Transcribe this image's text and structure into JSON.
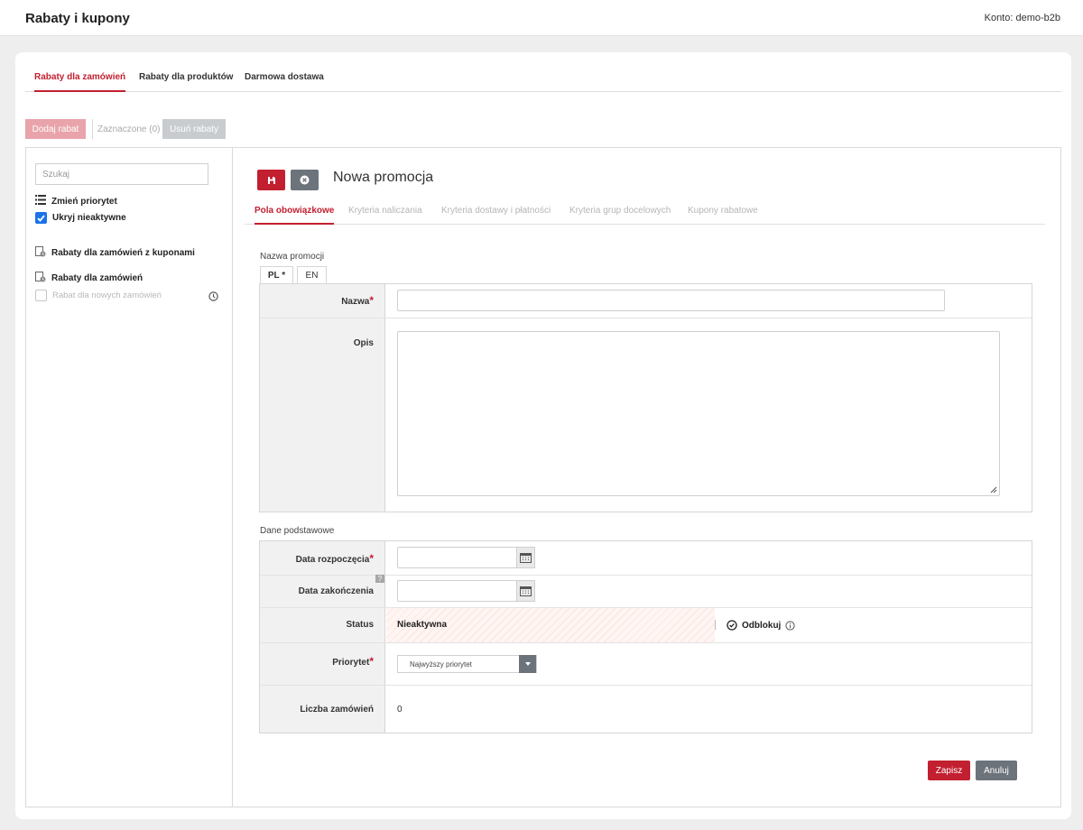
{
  "header": {
    "title": "Rabaty i kupony",
    "account": "Konto: demo-b2b"
  },
  "tabs": [
    {
      "label": "Rabaty dla zamówień"
    },
    {
      "label": "Rabaty dla produktów"
    },
    {
      "label": "Darmowa dostawa"
    }
  ],
  "toolbar": {
    "add_label": "Dodaj rabat",
    "selected_label": "Zaznaczone (0)",
    "delete_label": "Usuń rabaty"
  },
  "sidebar": {
    "search_placeholder": "Szukaj",
    "change_priority": "Zmień priorytet",
    "hide_inactive": "Ukryj nieaktywne",
    "group_coupons": "Rabaty dla zamówień z kuponami",
    "group_orders": "Rabaty dla zamówień",
    "item_new_orders": "Rabat dla nowych zamówień"
  },
  "form": {
    "title": "Nowa promocja",
    "subtabs": [
      {
        "label": "Pola obowiązkowe"
      },
      {
        "label": "Kryteria naliczania"
      },
      {
        "label": "Kryteria dostawy i płatności"
      },
      {
        "label": "Kryteria grup docelowych"
      },
      {
        "label": "Kupony rabatowe"
      }
    ],
    "section_name": "Nazwa promocji",
    "lang_pl": "PL *",
    "lang_en": "EN",
    "label_name": "Nazwa",
    "label_desc": "Opis",
    "section_basic": "Dane podstawowe",
    "label_start": "Data rozpoczęcia",
    "label_end": "Data zakończenia",
    "help_mark": "?",
    "label_status": "Status",
    "status_value": "Nieaktywna",
    "unlock_label": "Odblokuj",
    "label_priority": "Priorytet",
    "priority_value": "Najwyższy priorytet",
    "label_orders_count": "Liczba zamówień",
    "orders_count": "0",
    "required_mark": "*"
  },
  "buttons": {
    "save": "Zapisz",
    "cancel": "Anuluj"
  },
  "colors": {
    "accent": "#c22030",
    "secondary": "#6d737b",
    "checkbox": "#1a73e8"
  }
}
